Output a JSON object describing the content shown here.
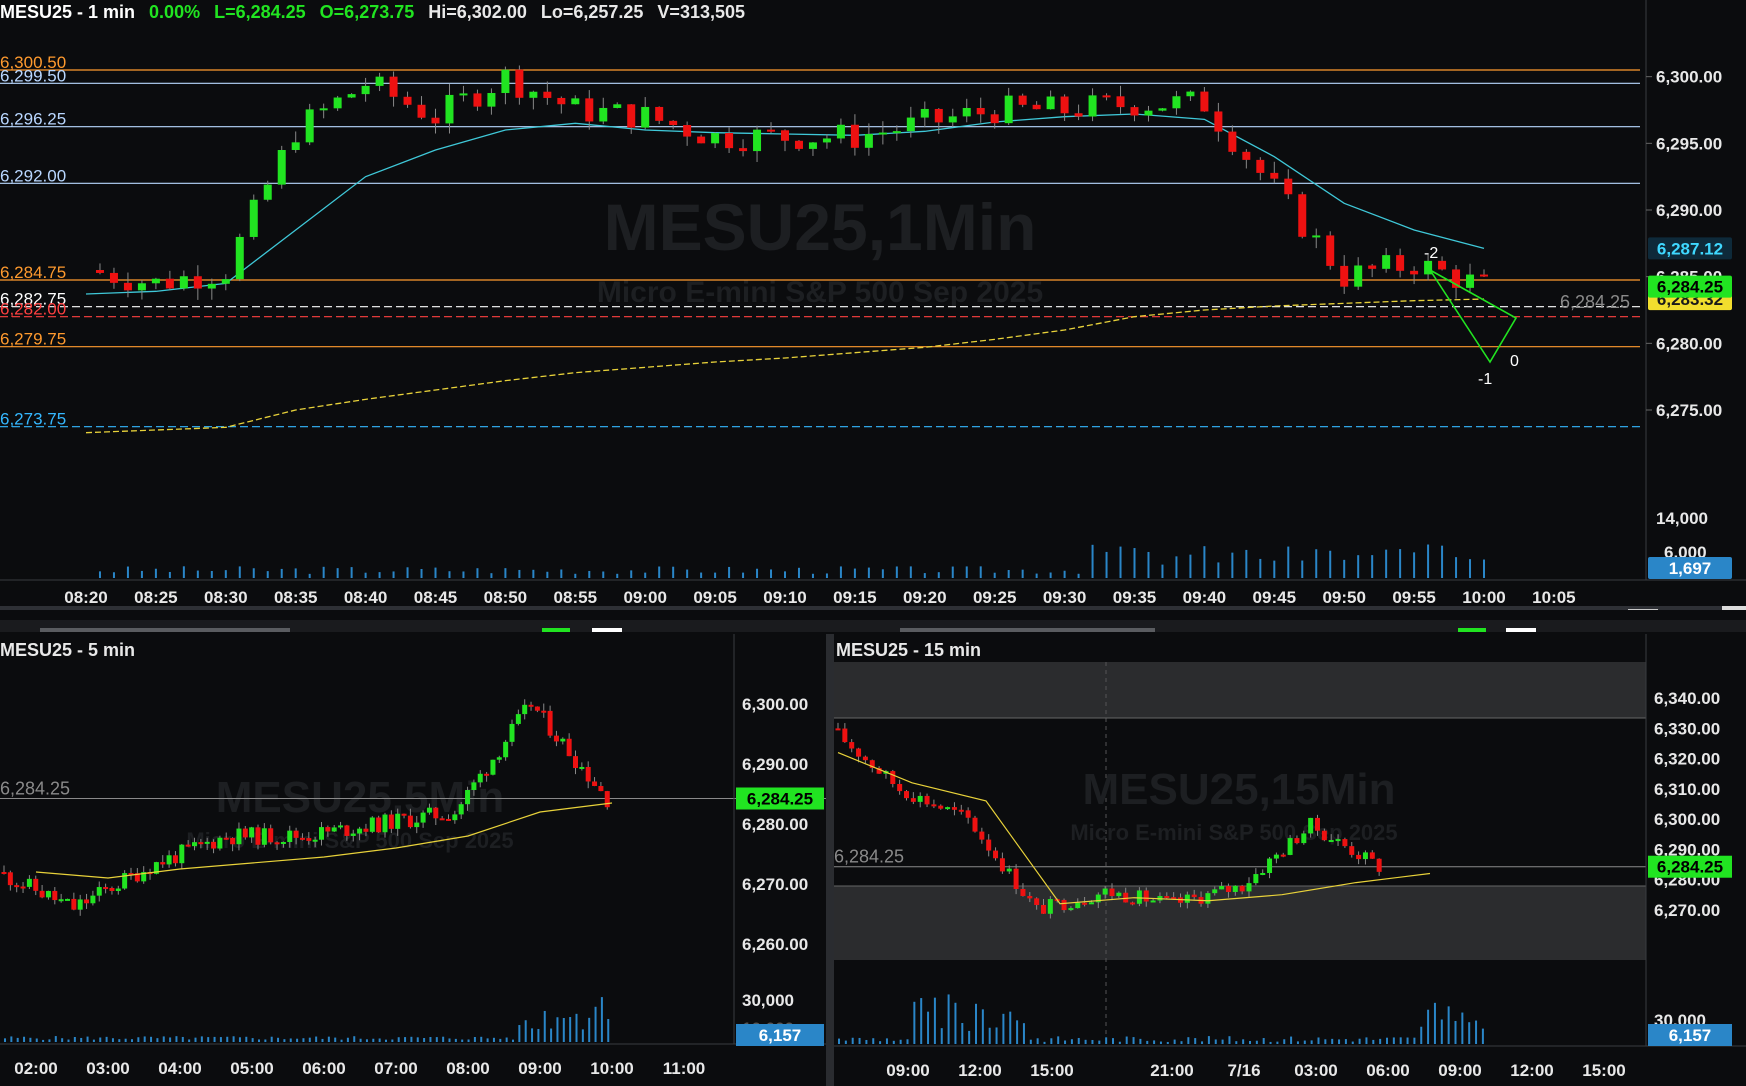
{
  "main": {
    "header": {
      "symbol": "MESU25 - 1 min",
      "change": "0.00%",
      "last": "L=6,284.25",
      "open": "O=6,273.75",
      "high": "Hi=6,302.00",
      "low": "Lo=6,257.25",
      "volume": "V=313,505"
    },
    "watermark": "MESU25,1Min",
    "watermark_sub": "Micro E-mini S&P 500 Sep 2025",
    "level_labels": [
      {
        "text": "6,300.50",
        "price": 6300.5,
        "color": "#ff9a2e"
      },
      {
        "text": "6,299.50",
        "price": 6299.5,
        "color": "#b9d7ff"
      },
      {
        "text": "6,296.25",
        "price": 6296.25,
        "color": "#b9d7ff"
      },
      {
        "text": "6,292.00",
        "price": 6292.0,
        "color": "#b9d7ff"
      },
      {
        "text": "6,284.75",
        "price": 6284.75,
        "color": "#ff9a2e"
      },
      {
        "text": "6,282.75",
        "price": 6282.75,
        "color": "#ffffff"
      },
      {
        "text": "6,282.00",
        "price": 6282.0,
        "color": "#ff4040"
      },
      {
        "text": "6,279.75",
        "price": 6279.75,
        "color": "#ff9a2e"
      },
      {
        "text": "6,273.75",
        "price": 6273.75,
        "color": "#35b8ff"
      }
    ],
    "price_ticks": [
      "6,300.00",
      "6,295.00",
      "6,290.00",
      "6,285.00",
      "6,280.00",
      "6,275.00"
    ],
    "volume_ticks": [
      "14,000",
      "6,000"
    ],
    "time_ticks": [
      "08:20",
      "08:25",
      "08:30",
      "08:35",
      "08:40",
      "08:45",
      "08:50",
      "08:55",
      "09:00",
      "09:05",
      "09:10",
      "09:15",
      "09:20",
      "09:25",
      "09:30",
      "09:35",
      "09:40",
      "09:45",
      "09:50",
      "09:55",
      "10:00",
      "10:05"
    ],
    "last_price_ghost": "6,284.25",
    "badges": {
      "ema": "6,287.12",
      "last": "6,284.25",
      "vwap": "6,283.32",
      "volume": "1,697"
    },
    "pivot_labels": [
      "-2",
      "-1",
      "0"
    ],
    "colors": {
      "up": "#21e421",
      "down": "#ee1111",
      "ema": "#3fc8d8",
      "vwap": "#e8d23a",
      "volume": "#2a86c8"
    }
  },
  "five": {
    "title": "MESU25 - 5 min",
    "watermark": "MESU25,5Min",
    "watermark_sub": "Micro E-mini S&P 500 Sep 2025",
    "last_price_ghost": "6,284.25",
    "price_ticks": [
      "6,300.00",
      "6,290.00",
      "6,280.00",
      "6,270.00",
      "6,260.00"
    ],
    "volume_ticks": [
      "30,000",
      "10,000"
    ],
    "time_ticks": [
      "02:00",
      "03:00",
      "04:00",
      "05:00",
      "06:00",
      "07:00",
      "08:00",
      "09:00",
      "10:00",
      "11:00"
    ],
    "badges": {
      "last": "6,284.25",
      "volume": "6,157"
    }
  },
  "fifteen": {
    "title": "MESU25 - 15 min",
    "watermark": "MESU25,15Min",
    "watermark_sub": "Micro E-mini S&P 500 Sep 2025",
    "last_price_ghost": "6,284.25",
    "price_ticks": [
      "6,340.00",
      "6,330.00",
      "6,320.00",
      "6,310.00",
      "6,300.00",
      "6,290.00",
      "6,280.00",
      "6,270.00"
    ],
    "volume_ticks": [
      "30,000"
    ],
    "time_ticks": [
      "09:00",
      "12:00",
      "15:00",
      "21:00",
      "7/16",
      "03:00",
      "06:00",
      "09:00",
      "12:00",
      "15:00"
    ],
    "badges": {
      "last": "6,284.25",
      "volume": "6,157"
    }
  },
  "chart_data": [
    {
      "type": "candlestick",
      "title": "MESU25 - 1 min",
      "x": [
        "08:20",
        "08:25",
        "08:30",
        "08:35",
        "08:40",
        "08:45",
        "08:50",
        "08:55",
        "09:00",
        "09:05",
        "09:10",
        "09:15",
        "09:20",
        "09:25",
        "09:30",
        "09:35",
        "09:40",
        "09:45",
        "09:50",
        "09:55",
        "10:00"
      ],
      "close": [
        6285.5,
        6284.5,
        6285.5,
        6296.0,
        6299.5,
        6297.0,
        6300.0,
        6297.5,
        6297.0,
        6295.5,
        6295.5,
        6295.5,
        6296.5,
        6297.5,
        6297.5,
        6298.0,
        6298.0,
        6291.5,
        6285.0,
        6286.0,
        6284.25
      ],
      "ylim": [
        6270.5,
        6303.5
      ],
      "series": [
        {
          "name": "EMA",
          "values": [
            6283.7,
            6283.9,
            6284.5,
            6288.5,
            6292.5,
            6294.5,
            6296.0,
            6296.5,
            6296.0,
            6295.8,
            6295.7,
            6295.6,
            6295.9,
            6296.6,
            6297.0,
            6297.2,
            6296.8,
            6294.0,
            6290.5,
            6288.5,
            6287.12
          ]
        },
        {
          "name": "VWAP",
          "values": [
            6273.3,
            6273.5,
            6273.7,
            6275.0,
            6275.8,
            6276.5,
            6277.2,
            6277.8,
            6278.2,
            6278.6,
            6278.9,
            6279.3,
            6279.7,
            6280.3,
            6281.0,
            6282.0,
            6282.5,
            6282.8,
            6283.0,
            6283.2,
            6283.32
          ]
        }
      ],
      "levels": [
        6300.5,
        6299.5,
        6296.25,
        6292.0,
        6284.75,
        6282.75,
        6282.0,
        6279.75,
        6273.75
      ],
      "last": 6284.25
    },
    {
      "type": "candlestick",
      "title": "MESU25 - 5 min",
      "x": [
        "02:00",
        "03:00",
        "04:00",
        "05:00",
        "06:00",
        "07:00",
        "08:00",
        "09:00",
        "10:00"
      ],
      "close": [
        6272.0,
        6266.0,
        6273.0,
        6278.0,
        6278.0,
        6280.0,
        6282.0,
        6300.0,
        6284.25
      ],
      "ylim": [
        6255,
        6305
      ]
    },
    {
      "type": "candlestick",
      "title": "MESU25 - 15 min",
      "x": [
        "09:00",
        "12:00",
        "15:00",
        "21:00",
        "7/16",
        "03:00",
        "06:00",
        "09:00",
        "12:00"
      ],
      "close": [
        6330.0,
        6310.0,
        6300.0,
        6270.0,
        6276.0,
        6272.0,
        6278.0,
        6298.0,
        6284.25
      ],
      "ylim": [
        6262,
        6346
      ]
    }
  ]
}
